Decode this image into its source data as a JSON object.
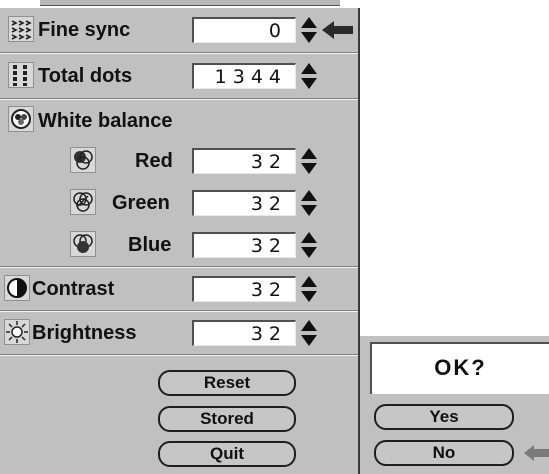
{
  "settings": {
    "fine_sync": {
      "label": "Fine sync",
      "value": "0"
    },
    "total_dots": {
      "label": "Total dots",
      "value": "1344"
    },
    "white_balance": {
      "label": "White balance"
    },
    "red": {
      "label": "Red",
      "value": "32"
    },
    "green": {
      "label": "Green",
      "value": "32"
    },
    "blue": {
      "label": "Blue",
      "value": "32"
    },
    "contrast": {
      "label": "Contrast",
      "value": "32"
    },
    "brightness": {
      "label": "Brightness",
      "value": "32"
    }
  },
  "buttons": {
    "reset": "Reset",
    "stored": "Stored",
    "quit": "Quit"
  },
  "dialog": {
    "prompt": "OK?",
    "yes": "Yes",
    "no": "No"
  },
  "icons": {
    "fine_sync": "fine-sync-icon",
    "total_dots": "total-dots-icon",
    "white_balance": "white-balance-icon",
    "red": "red-channel-icon",
    "green": "green-channel-icon",
    "blue": "blue-channel-icon",
    "contrast": "contrast-icon",
    "brightness": "brightness-sun-icon",
    "pointer": "pointer-arrow-left-icon"
  },
  "colors": {
    "panel": "#c0c0c0",
    "field": "#ffffff",
    "text": "#111111"
  }
}
